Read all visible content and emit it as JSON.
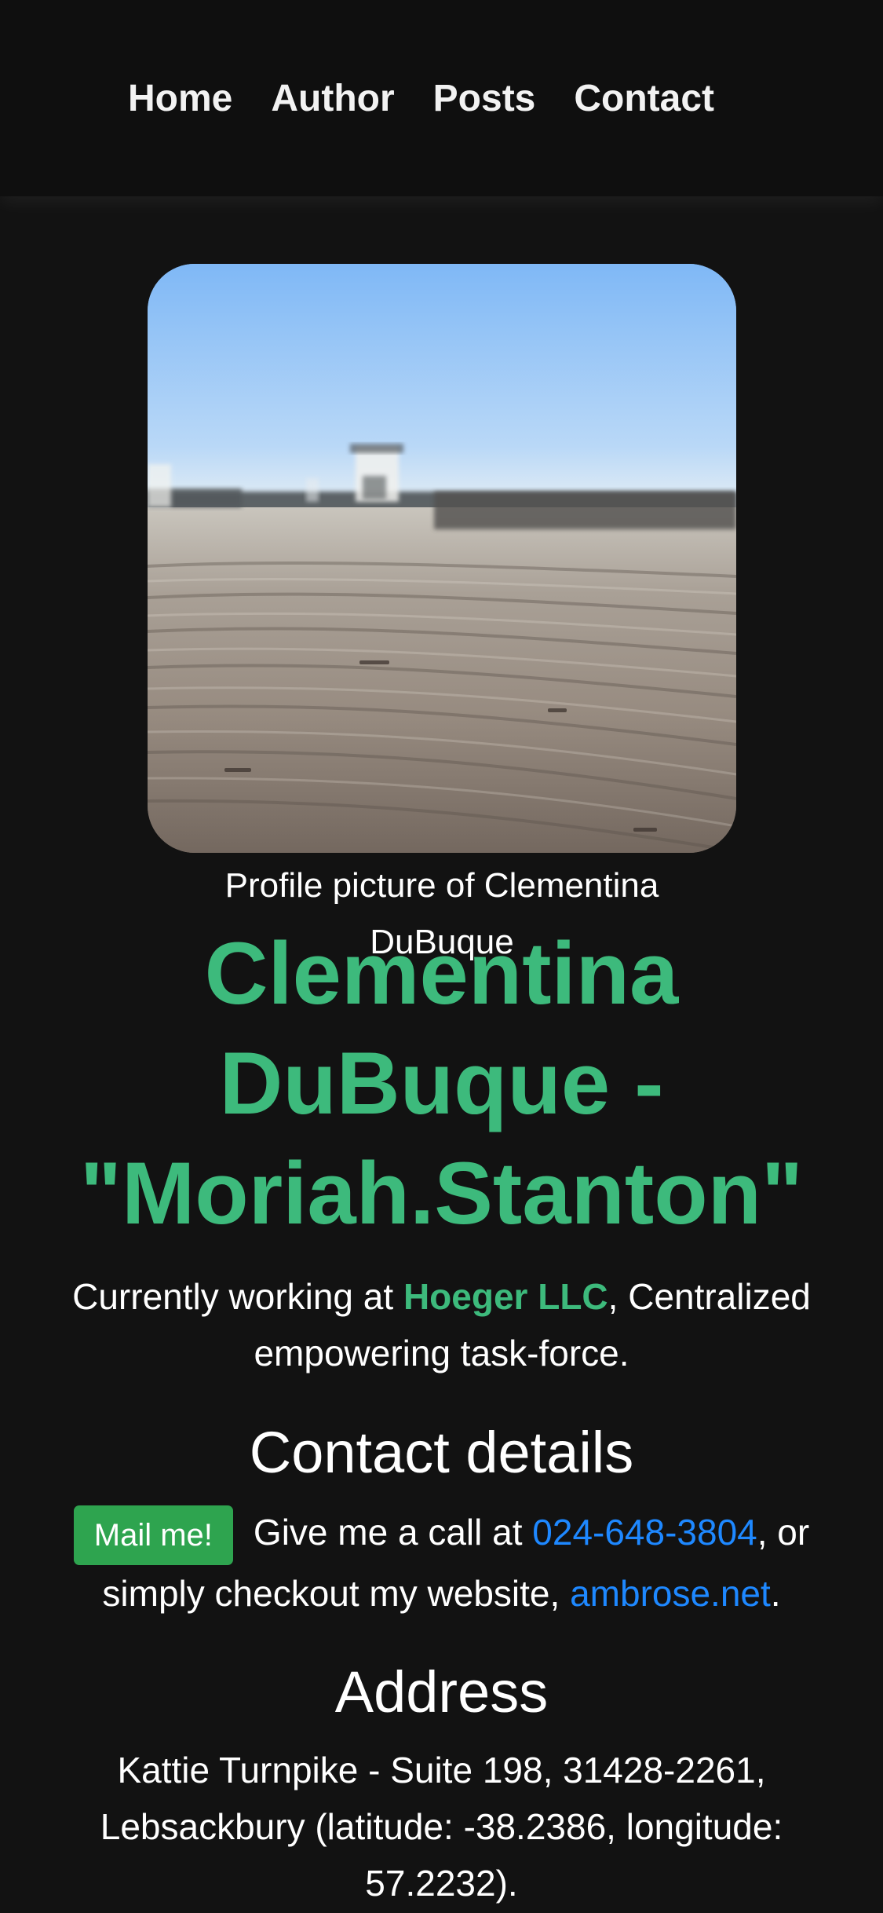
{
  "nav": {
    "items": [
      {
        "label": "Home"
      },
      {
        "label": "Author"
      },
      {
        "label": "Posts"
      },
      {
        "label": "Contact"
      }
    ]
  },
  "profile": {
    "image_alt": "Profile picture of Clementina DuBuque",
    "caption": "Profile picture of Clementina DuBuque",
    "name": "Clementina DuBuque - \"Moriah.Stanton\""
  },
  "intro": {
    "prefix": "Currently working at ",
    "company": "Hoeger LLC",
    "suffix": ", Centralized empowering task-force."
  },
  "contact": {
    "heading": "Contact details",
    "mail_button": "Mail me!",
    "call_text": "Give me a call at ",
    "phone": "024-648-3804",
    "middle_text": ", or simply checkout my website, ",
    "website": "ambrose.net",
    "end_text": "."
  },
  "address": {
    "heading": "Address",
    "text": "Kattie Turnpike - Suite 198, 31428-2261, Lebsackbury (latitude: -38.2386, longitude: 57.2232)."
  },
  "colors": {
    "background": "#121212",
    "accent_green": "#3dba7c",
    "link_blue": "#1e88ff",
    "button_green": "#2ea44f"
  }
}
